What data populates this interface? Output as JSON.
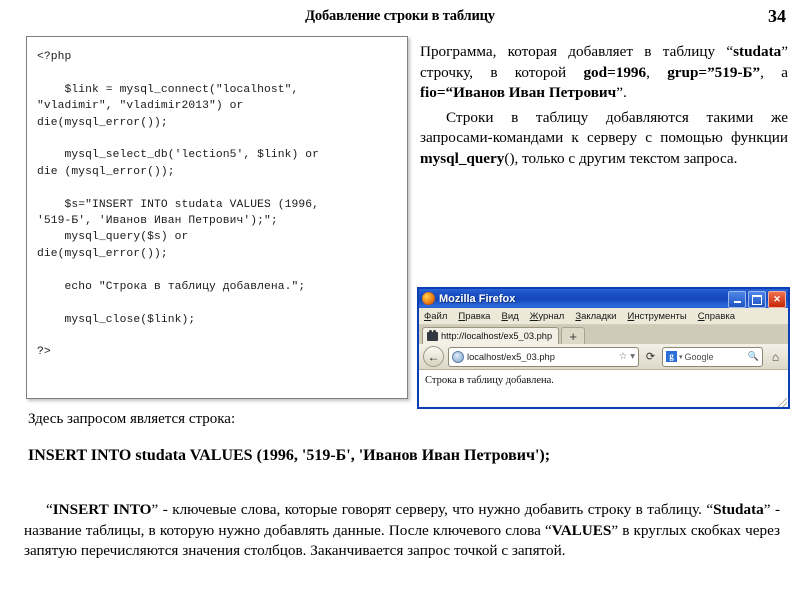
{
  "header": {
    "title": "Добавление строки в таблицу",
    "page_number": "34"
  },
  "code_box": {
    "language": "php",
    "code": "<?php\n\n    $link = mysql_connect(\"localhost\",\n\"vladimir\", \"vladimir2013\") or\ndie(mysql_error());\n\n    mysql_select_db('lection5', $link) or\ndie (mysql_error());\n\n    $s=\"INSERT INTO studata VALUES (1996,\n'519-Б', 'Иванов Иван Петрович');\";\n    mysql_query($s) or\ndie(mysql_error());\n\n    echo \"Строка в таблицу добавлена.\";\n\n    mysql_close($link);\n\n?>"
  },
  "right_column": {
    "paragraph_1": {
      "part_1": "Программа, которая добавляет в таблицу “",
      "bold_1": "studata",
      "part_2": "” строчку, в которой ",
      "bold_2": "god=1996",
      "part_3": ", ",
      "bold_3": "grup=”519-Б”",
      "part_4": ", а ",
      "bold_4": "fio=“Иванов Иван Петрович",
      "part_5": "”."
    },
    "paragraph_2": {
      "part_1": "Строки в таблицу добавляются такими же запросами-командами к серверу с помощью функции ",
      "bold_1": "mysql_query",
      "part_2": "(), только с другим текстом запроса."
    }
  },
  "firefox_window": {
    "title": "Mozilla Firefox",
    "window_buttons": {
      "minimize": "_",
      "maximize": "□",
      "close": "✕"
    },
    "menu_items": [
      {
        "accel": "Ф",
        "rest": "айл"
      },
      {
        "accel": "П",
        "rest": "равка"
      },
      {
        "accel": "В",
        "rest": "ид"
      },
      {
        "accel": "Ж",
        "rest": "урнал"
      },
      {
        "accel": "З",
        "rest": "акладки"
      },
      {
        "accel": "И",
        "rest": "нструменты"
      },
      {
        "accel": "С",
        "rest": "правка"
      }
    ],
    "tab_label": "http://localhost/ex5_03.php",
    "new_tab_label": "+",
    "back_button_label": "←",
    "url_value": "localhost/ex5_03.php",
    "bookmark_star": "☆",
    "url_dropdown": "▾",
    "reload_label": "⟳",
    "search_engine_letter": "g",
    "search_caret": "▾",
    "search_placeholder": "Google",
    "search_magnifier": "🔍",
    "home_label": "⌂",
    "page_text": "Строка в таблицу добавлена."
  },
  "bottom": {
    "lead_in": "Здесь запросом является строка:",
    "sql_line": "INSERT INTO studata VALUES (1996, '519-Б', 'Иванов Иван Петрович');",
    "paragraph": {
      "p1": "“",
      "b1": "INSERT INTO",
      "p2": "” - ключевые слова, которые говорят серверу, что нужно добавить строку в таблицу. “",
      "b2": "Studata",
      "p3": "” - название таблицы, в которую нужно добавлять данные. После ключевого слова “",
      "b3": "VALUES",
      "p4": "” в круглых скобках через запятую перечисляются значения столбцов.  Заканчивается запрос точкой с запятой."
    }
  }
}
